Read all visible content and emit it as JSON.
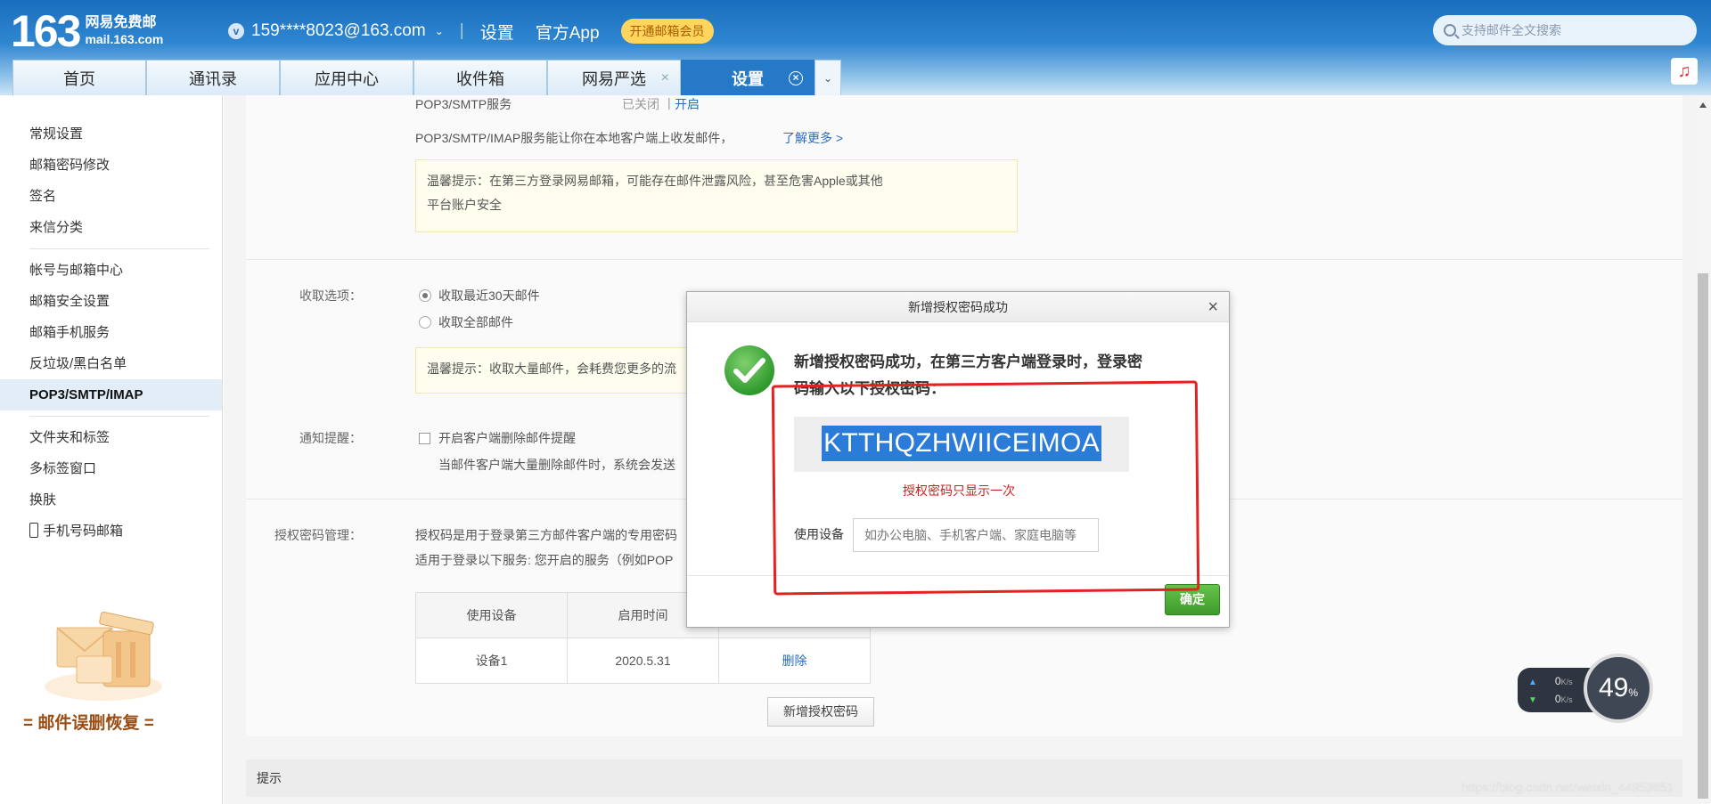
{
  "header": {
    "logo_number": "163",
    "logo_title": "网易免费邮",
    "logo_domain": "mail.163.com",
    "account_badge": "v",
    "account": "159****8023@163.com",
    "settings_link": "设置",
    "app_link": "官方App",
    "vip_button": "开通邮箱会员",
    "search_placeholder": "支持邮件全文搜索"
  },
  "tabs": [
    {
      "label": "首页"
    },
    {
      "label": "通讯录"
    },
    {
      "label": "应用中心"
    },
    {
      "label": "收件箱"
    },
    {
      "label": "网易严选"
    },
    {
      "label": "设置"
    }
  ],
  "sidebar": {
    "group1": [
      "常规设置",
      "邮箱密码修改",
      "签名",
      "来信分类"
    ],
    "group2": [
      "帐号与邮箱中心",
      "邮箱安全设置",
      "邮箱手机服务",
      "反垃圾/黑白名单",
      "POP3/SMTP/IMAP"
    ],
    "group3": [
      "文件夹和标签",
      "多标签窗口",
      "换肤",
      "手机号码邮箱"
    ],
    "promo": "邮件误删恢复"
  },
  "main": {
    "service_name": "POP3/SMTP服务",
    "service_status": "已关闭",
    "service_sep": "|",
    "service_open": "开启",
    "service_desc": "POP3/SMTP/IMAP服务能让你在本地客户端上收发邮件，",
    "learn_more": "了解更多 >",
    "tip1_line1": "温馨提示：在第三方登录网易邮箱，可能存在邮件泄露风险，甚至危害Apple或其他",
    "tip1_line2": "平台账户安全",
    "fetch_label": "收取选项：",
    "fetch_recent": "收取最近30天邮件",
    "fetch_all": "收取全部邮件",
    "tip2": "温馨提示：收取大量邮件，会耗费您更多的流",
    "notify_label": "通知提醒：",
    "notify_option": "开启客户端删除邮件提醒",
    "notify_desc": "当邮件客户端大量删除邮件时，系统会发送",
    "auth_label": "授权密码管理：",
    "auth_desc1": "授权码是用于登录第三方邮件客户端的专用密码",
    "auth_desc2": "适用于登录以下服务: 您开启的服务（例如POP",
    "table_headers": [
      "使用设备",
      "启用时间",
      ""
    ],
    "table_rows": [
      {
        "device": "设备1",
        "date": "2020.5.31",
        "action": "删除"
      }
    ],
    "add_button": "新增授权密码",
    "hint_title": "提示"
  },
  "dialog": {
    "title": "新增授权密码成功",
    "message": "新增授权密码成功，在第三方客户端登录时，登录密码输入以下授权密码：",
    "code": "KTTHQZHWIICEIMOA",
    "note": "授权密码只显示一次",
    "device_label": "使用设备",
    "device_placeholder": "如办公电脑、手机客户端、家庭电脑等",
    "ok_button": "确定"
  },
  "speed_widget": {
    "up": "0",
    "down": "0",
    "unit": "K/s",
    "percent": "49",
    "percent_sign": "%"
  },
  "watermark": "https://blog.csdn.net/weixin_44953651"
}
